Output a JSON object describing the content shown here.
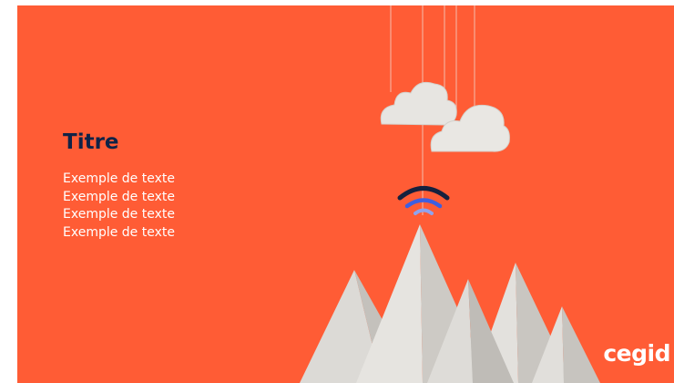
{
  "slide": {
    "title": "Titre",
    "body_lines": [
      "Exemple de texte",
      "Exemple de texte",
      "Exemple de texte",
      "Exemple de texte"
    ],
    "logo": "cegid"
  },
  "colors": {
    "background": "#ff5c35",
    "title": "#102347",
    "text": "#ffffff",
    "paper": "#e7e5e1",
    "signal_dark": "#16213e",
    "signal_mid": "#3e5fe0",
    "signal_light": "#8fa3ee"
  },
  "icons": [
    "cloud-icon",
    "wifi-signal-icon",
    "mountain-icon"
  ]
}
